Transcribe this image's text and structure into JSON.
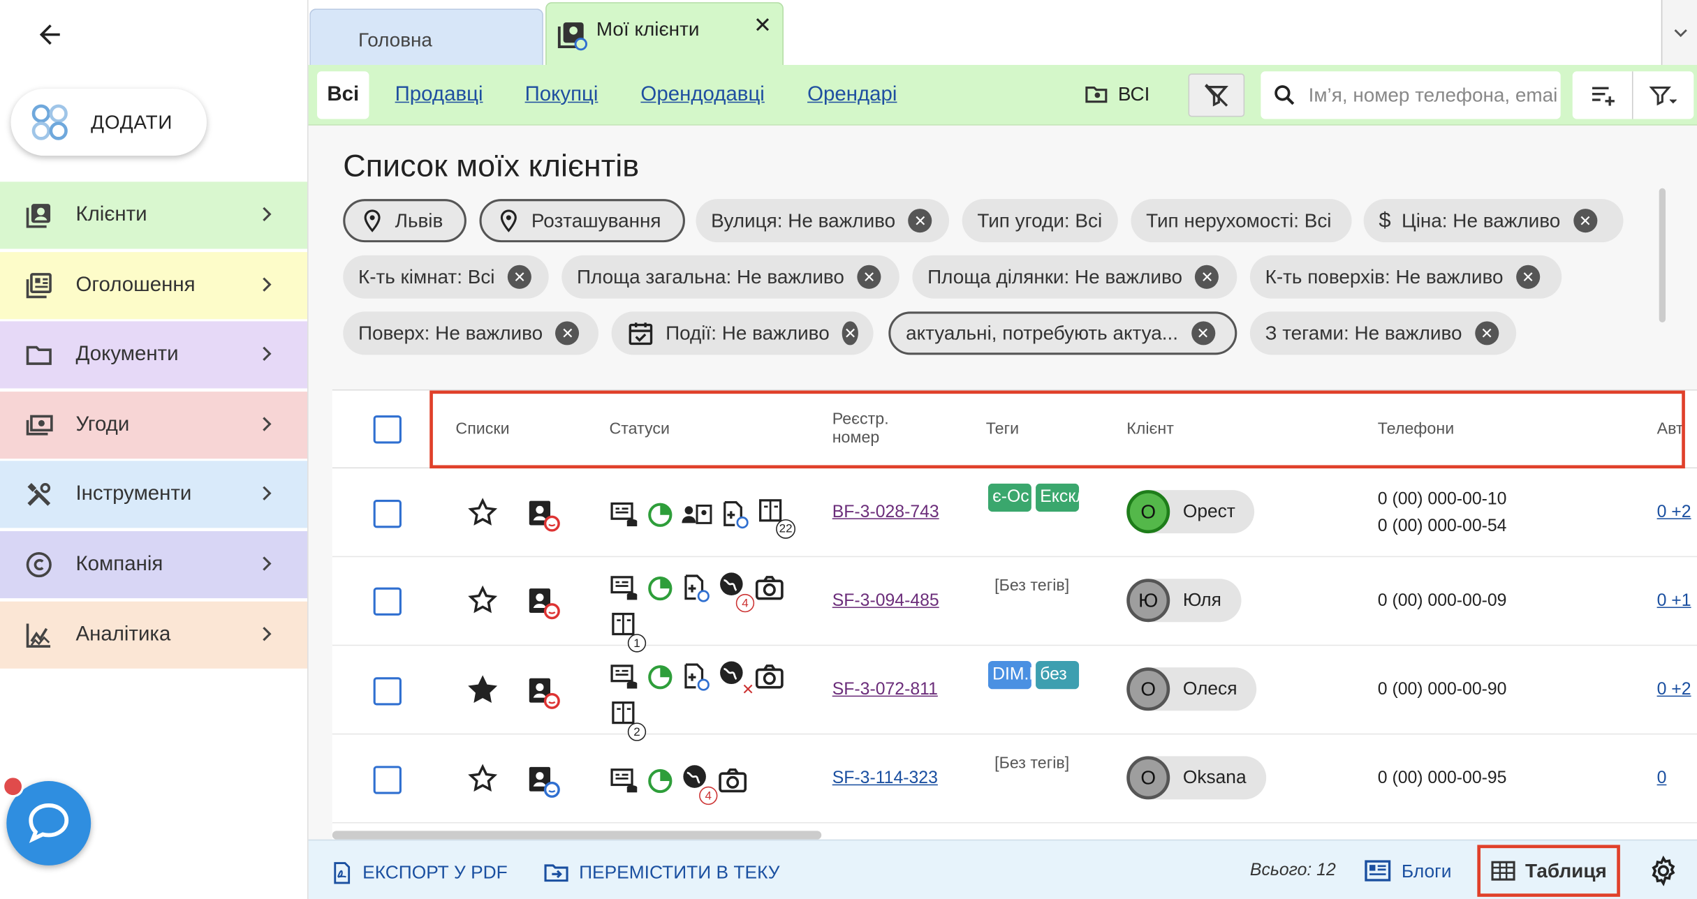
{
  "sidebar": {
    "add_label": "ДОДАТИ",
    "items": [
      {
        "label": "Клієнти",
        "color": "#d9f7cf",
        "icon": "clients-icon"
      },
      {
        "label": "Оголошення",
        "color": "#fdfcc9",
        "icon": "listing-icon"
      },
      {
        "label": "Документи",
        "color": "#e6d9f7",
        "icon": "folder-icon"
      },
      {
        "label": "Угоди",
        "color": "#f7d5d5",
        "icon": "deal-icon"
      },
      {
        "label": "Інструменти",
        "color": "#d9eafa",
        "icon": "tools-icon"
      },
      {
        "label": "Компанія",
        "color": "#d8d6f5",
        "icon": "copyright-icon"
      },
      {
        "label": "Аналітика",
        "color": "#fbe6d5",
        "icon": "analytics-icon"
      }
    ]
  },
  "tabs": {
    "home": "Головна",
    "active": "Мої клієнти"
  },
  "filter_tabs": {
    "all": "Всі",
    "sellers": "Продавці",
    "buyers": "Покупці",
    "landlords": "Орендодавці",
    "tenants": "Орендарі",
    "folder": "ВСІ"
  },
  "search": {
    "placeholder": "Ім’я, номер телефона, email"
  },
  "page_title": "Список моїх клієнтів",
  "chips": {
    "city": "Львів",
    "location": "Розташування",
    "street": "Вулиця: Не важливо",
    "deal_type": "Тип угоди: Всі",
    "property_type": "Тип нерухомості: Всі",
    "price": "Ціна: Не важливо",
    "rooms": "К-ть кімнат: Всі",
    "total_area": "Площа загальна: Не важливо",
    "plot_area": "Площа ділянки: Не важливо",
    "floors": "К-ть поверхів: Не важливо",
    "floor": "Поверх: Не важливо",
    "events": "Події: Не важливо",
    "actual": "актуальні, потребують актуа...",
    "tags": "З тегами: Не важливо"
  },
  "table": {
    "headers": {
      "lists": "Списки",
      "statuses": "Статуси",
      "reg": "Реєстр. номер",
      "tags": "Теги",
      "client": "Клієнт",
      "phones": "Телефони",
      "author": "Авт"
    },
    "rows": [
      {
        "reg": "BF-3-028-743",
        "tag1": "є-Ос",
        "tag2": "Ексклюзив",
        "client_initial": "О",
        "client": "Орест",
        "phone1": "0 (00) 000-00-10",
        "phone2": "0 (00) 000-00-54",
        "extra": "0 +2",
        "badge": "22"
      },
      {
        "reg": "SF-3-094-485",
        "notags": "[Без тегів]",
        "client_initial": "Ю",
        "client": "Юля",
        "phone1": "0 (00) 000-00-09",
        "extra": "0 +1",
        "badge1": "4",
        "badge2": "1"
      },
      {
        "reg": "SF-3-072-811",
        "tag1": "DIM.RIA",
        "tag2": "без",
        "client_initial": "О",
        "client": "Олеся",
        "phone1": "0 (00) 000-00-90",
        "extra": "0 +2",
        "badge2": "2"
      },
      {
        "reg": "SF-3-114-323",
        "notags": "[Без тегів]",
        "client_initial": "О",
        "client": "Oksana",
        "phone1": "0 (00) 000-00-95",
        "extra": "0",
        "badge1": "4"
      }
    ]
  },
  "footer": {
    "export": "ЕКСПОРТ У PDF",
    "move": "ПЕРЕМІСТИТИ В ТЕКУ",
    "total": "Всього: 12",
    "blogs": "Блоги",
    "table": "Таблиця"
  },
  "colors": {
    "accent": "#2f6fd0",
    "highlight": "#e0402a",
    "tab_active": "#d4f7c9",
    "tab_home": "#d7e6f8"
  }
}
